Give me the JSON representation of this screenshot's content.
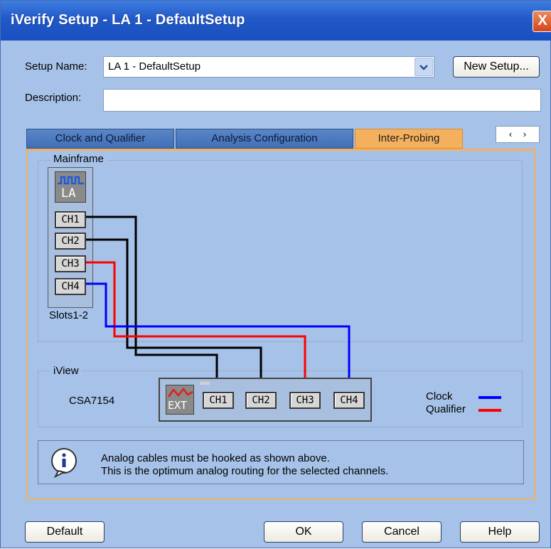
{
  "window": {
    "title": "iVerify Setup - LA 1 - DefaultSetup",
    "close_glyph": "X"
  },
  "setup": {
    "name_label": "Setup Name:",
    "name_value": "LA 1 - DefaultSetup",
    "new_setup_label": "New Setup...",
    "description_label": "Description:",
    "description_value": ""
  },
  "tabs": [
    {
      "label": "Clock and Qualifier",
      "active": false
    },
    {
      "label": "Analysis Configuration",
      "active": false
    },
    {
      "label": "Inter-Probing",
      "active": true
    }
  ],
  "tab_nav": {
    "prev": "‹",
    "next": "›"
  },
  "mainframe": {
    "group_title": "Mainframe",
    "module_icon": "logic-analyzer-icon",
    "module_label": "LA",
    "channels": [
      "CH1",
      "CH2",
      "CH3",
      "CH4"
    ],
    "slot_label": "Slots1-2"
  },
  "iview": {
    "group_title": "iView",
    "scope_name": "CSA7154",
    "ext_icon": "scope-waveform-icon",
    "ext_label": "EXT",
    "channels": [
      "CH1",
      "CH2",
      "CH3",
      "CH4"
    ]
  },
  "legend": {
    "clock_label": "Clock",
    "qualifier_label": "Qualifier",
    "clock_color": "#0000ff",
    "qualifier_color": "#ff0000"
  },
  "cable_colors": {
    "ch1": "#000000",
    "ch2": "#000000",
    "ch3": "#ff0000",
    "ch4": "#0000ff"
  },
  "info": {
    "icon": "info-icon",
    "line1": "Analog cables must be hooked as shown above.",
    "line2": "This is the optimum analog routing for the selected channels."
  },
  "buttons": {
    "default": "Default",
    "ok": "OK",
    "cancel": "Cancel",
    "help": "Help"
  }
}
